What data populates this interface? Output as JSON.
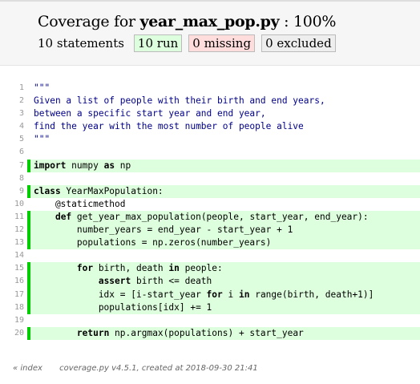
{
  "header": {
    "title_prefix": "Coverage for ",
    "file": "year_max_pop.py",
    "title_suffix": " : 100%",
    "statements": "10 statements",
    "run": "10 run",
    "missing": "0 missing",
    "excluded": "0 excluded"
  },
  "lines": [
    {
      "n": "1",
      "run": false,
      "tokens": [
        {
          "t": "\"\"\"",
          "c": "s"
        }
      ]
    },
    {
      "n": "2",
      "run": false,
      "tokens": [
        {
          "t": "Given a list of people with their birth and end years,",
          "c": "s"
        }
      ]
    },
    {
      "n": "3",
      "run": false,
      "tokens": [
        {
          "t": "between a specific start year and end year,",
          "c": "s"
        }
      ]
    },
    {
      "n": "4",
      "run": false,
      "tokens": [
        {
          "t": "find the year with the most number of people alive",
          "c": "s"
        }
      ]
    },
    {
      "n": "5",
      "run": false,
      "tokens": [
        {
          "t": "\"\"\"",
          "c": "s"
        }
      ]
    },
    {
      "n": "6",
      "run": false,
      "tokens": []
    },
    {
      "n": "7",
      "run": true,
      "tokens": [
        {
          "t": "import",
          "c": "k"
        },
        {
          "t": " numpy ",
          "c": ""
        },
        {
          "t": "as",
          "c": "k"
        },
        {
          "t": " np",
          "c": ""
        }
      ]
    },
    {
      "n": "8",
      "run": false,
      "tokens": []
    },
    {
      "n": "9",
      "run": true,
      "tokens": [
        {
          "t": "class",
          "c": "k"
        },
        {
          "t": " YearMaxPopulation:",
          "c": ""
        }
      ]
    },
    {
      "n": "10",
      "run": false,
      "tokens": [
        {
          "t": "    @staticmethod",
          "c": ""
        }
      ]
    },
    {
      "n": "11",
      "run": true,
      "tokens": [
        {
          "t": "    ",
          "c": ""
        },
        {
          "t": "def",
          "c": "k"
        },
        {
          "t": " get_year_max_population(people, start_year, end_year):",
          "c": ""
        }
      ]
    },
    {
      "n": "12",
      "run": true,
      "tokens": [
        {
          "t": "        number_years = end_year - start_year + 1",
          "c": ""
        }
      ]
    },
    {
      "n": "13",
      "run": true,
      "tokens": [
        {
          "t": "        populations = np.zeros(number_years)",
          "c": ""
        }
      ]
    },
    {
      "n": "14",
      "run": false,
      "tokens": []
    },
    {
      "n": "15",
      "run": true,
      "tokens": [
        {
          "t": "        ",
          "c": ""
        },
        {
          "t": "for",
          "c": "k"
        },
        {
          "t": " birth, death ",
          "c": ""
        },
        {
          "t": "in",
          "c": "k"
        },
        {
          "t": " people:",
          "c": ""
        }
      ]
    },
    {
      "n": "16",
      "run": true,
      "tokens": [
        {
          "t": "            ",
          "c": ""
        },
        {
          "t": "assert",
          "c": "k"
        },
        {
          "t": " birth <= death",
          "c": ""
        }
      ]
    },
    {
      "n": "17",
      "run": true,
      "tokens": [
        {
          "t": "            idx = [i-start_year ",
          "c": ""
        },
        {
          "t": "for",
          "c": "k"
        },
        {
          "t": " i ",
          "c": ""
        },
        {
          "t": "in",
          "c": "k"
        },
        {
          "t": " range(birth, death+1)]",
          "c": ""
        }
      ]
    },
    {
      "n": "18",
      "run": true,
      "tokens": [
        {
          "t": "            populations[idx] += 1",
          "c": ""
        }
      ]
    },
    {
      "n": "19",
      "run": false,
      "tokens": []
    },
    {
      "n": "20",
      "run": true,
      "tokens": [
        {
          "t": "        ",
          "c": ""
        },
        {
          "t": "return",
          "c": "k"
        },
        {
          "t": " np.argmax(populations) + start_year",
          "c": ""
        }
      ]
    }
  ],
  "footer": {
    "index_link": "« index",
    "created": "coverage.py v4.5.1, created at 2018-09-30 21:41"
  }
}
